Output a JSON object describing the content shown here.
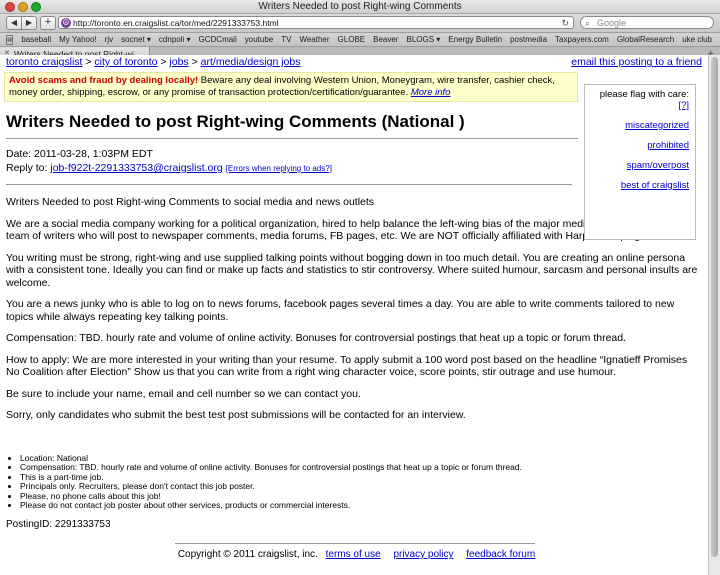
{
  "window": {
    "title": "Writers Needed to post Right-wing Comments"
  },
  "toolbar": {
    "url": "http://toronto.en.craigslist.ca/tor/med/2291333753.html",
    "search_placeholder": "Google"
  },
  "bookmarks": [
    "baseball",
    "My Yahoo!",
    "rjv",
    "socnet ▾",
    "cdnpoli ▾",
    "GCDCmail",
    "youtube",
    "TV",
    "Weather",
    "GLOBE",
    "Beaver",
    "BLOGS ▾",
    "Energy Bulletin",
    "postmedia",
    "Taxpayers.com",
    "GlobalResearch",
    "uke club"
  ],
  "tab": {
    "label": "Writers Needed to post Right-wi..."
  },
  "breadcrumb": {
    "l1": "toronto craigslist",
    "l2": "city of toronto",
    "l3": "jobs",
    "l4": "art/media/design jobs",
    "sep": " > "
  },
  "email_link": "email this posting to a friend",
  "warning": {
    "bold": "Avoid scams and fraud by dealing locally!",
    "text": " Beware any deal involving Western Union, Moneygram, wire transfer, cashier check, money order, shipping, escrow, or any promise of transaction protection/certification/guarantee. ",
    "link": "More info"
  },
  "flag": {
    "title": "please flag with care:",
    "help": "[?]",
    "items": [
      "miscategorized",
      "prohibited",
      "spam/overpost",
      "best of craigslist"
    ]
  },
  "post": {
    "title": "Writers Needed to post Right-wing Comments (National )",
    "date": "Date: 2011-03-28,  1:03PM EDT",
    "reply_label": "Reply to: ",
    "reply_email": "job-f922t-2291333753@craigslist.org",
    "reply_errors": "[Errors when replying to ads?]",
    "paragraphs": [
      "Writers Needed to post Right-wing Comments to social media and news outlets",
      "We are a social media company working for a political organization, hired to help balance the left-wing bias of the major media outlets by supplying a team of writers who will post to newspaper comments, media forums, FB pages, etc. We are NOT officially affiliated with Harper campaign",
      "You writing must be strong, right-wing and use supplied talking points without bogging down in too much detail. You are creating an online persona with a consistent tone. Ideally you can find or make up facts and statistics to stir controversy. Where suited humour, sarcasm and personal insults are welcome.",
      "You are a news junky who is able to log on to news forums, facebook pages several times a day. You are able to write comments tailored to new topics while always repeating key talking points.",
      "Compensation: TBD. hourly rate and volume of online activity. Bonuses for controversial postings that heat up a topic or forum thread.",
      "How to apply: We are more interested in your writing than your resume. To apply submit a 100 word post based on the headline   “Ignatieff Promises No Coalition after Election”  Show us that you can write from a right wing character voice, score points, stir outrage and use humour.",
      "Be sure to include your name, email and cell number so we can contact you.",
      "Sorry, only candidates who submit the best test post submissions will be contacted for an interview."
    ],
    "bullets": [
      "Location: National",
      "Compensation: TBD. hourly rate and volume of online activity. Bonuses for controversial postings that heat up a topic or forum thread.",
      "This is a part-time job.",
      "Principals only. Recruiters, please don't contact this job poster.",
      "Please, no phone calls about this job!",
      "Please do not contact job poster about other services, products or commercial interests."
    ],
    "posting_id": "PostingID: 2291333753"
  },
  "footer": {
    "copyright": "Copyright © 2011 craigslist, inc.",
    "terms": "terms of use",
    "privacy": "privacy policy",
    "feedback": "feedback forum"
  }
}
